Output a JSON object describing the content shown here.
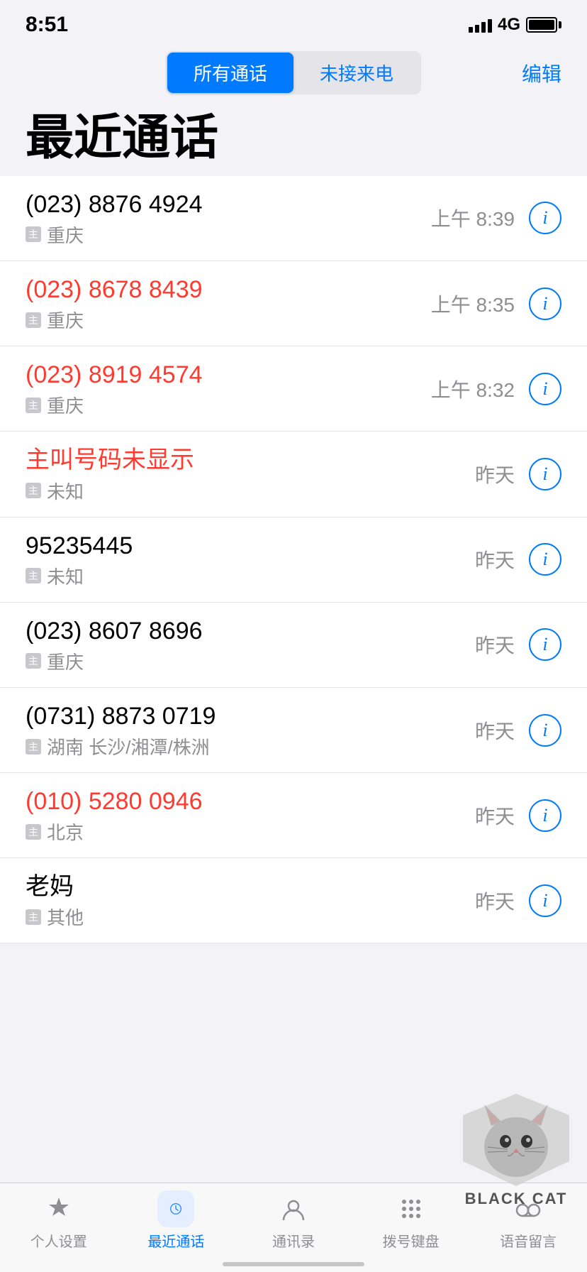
{
  "statusBar": {
    "time": "8:51",
    "network": "4G"
  },
  "segmented": {
    "allCalls": "所有通话",
    "missedCalls": "未接来电",
    "editLabel": "编辑",
    "activeTab": "allCalls"
  },
  "pageTitle": "最近通话",
  "calls": [
    {
      "id": 1,
      "number": "(023) 8876 4924",
      "location": "重庆",
      "time": "上午 8:39",
      "missed": false
    },
    {
      "id": 2,
      "number": "(023) 8678 8439",
      "location": "重庆",
      "time": "上午 8:35",
      "missed": true
    },
    {
      "id": 3,
      "number": "(023) 8919 4574",
      "location": "重庆",
      "time": "上午 8:32",
      "missed": true
    },
    {
      "id": 4,
      "number": "主叫号码未显示",
      "location": "未知",
      "time": "昨天",
      "missed": true
    },
    {
      "id": 5,
      "number": "95235445",
      "location": "未知",
      "time": "昨天",
      "missed": false
    },
    {
      "id": 6,
      "number": "(023) 8607 8696",
      "location": "重庆",
      "time": "昨天",
      "missed": false
    },
    {
      "id": 7,
      "number": "(0731) 8873 0719",
      "location": "湖南 长沙/湘潭/株洲",
      "time": "昨天",
      "missed": false
    },
    {
      "id": 8,
      "number": "(010) 5280 0946",
      "location": "北京",
      "time": "昨天",
      "missed": true
    },
    {
      "id": 9,
      "number": "老妈",
      "location": "其他",
      "time": "昨天",
      "missed": false
    }
  ],
  "tabBar": {
    "items": [
      {
        "id": "favorites",
        "label": "个人设置",
        "active": false
      },
      {
        "id": "recents",
        "label": "最近通话",
        "active": true
      },
      {
        "id": "contacts",
        "label": "通讯录",
        "active": false
      },
      {
        "id": "keypad",
        "label": "拨号键盘",
        "active": false
      },
      {
        "id": "voicemail",
        "label": "语音留言",
        "active": false
      }
    ]
  },
  "watermark": {
    "text": "BLACK CAT"
  }
}
